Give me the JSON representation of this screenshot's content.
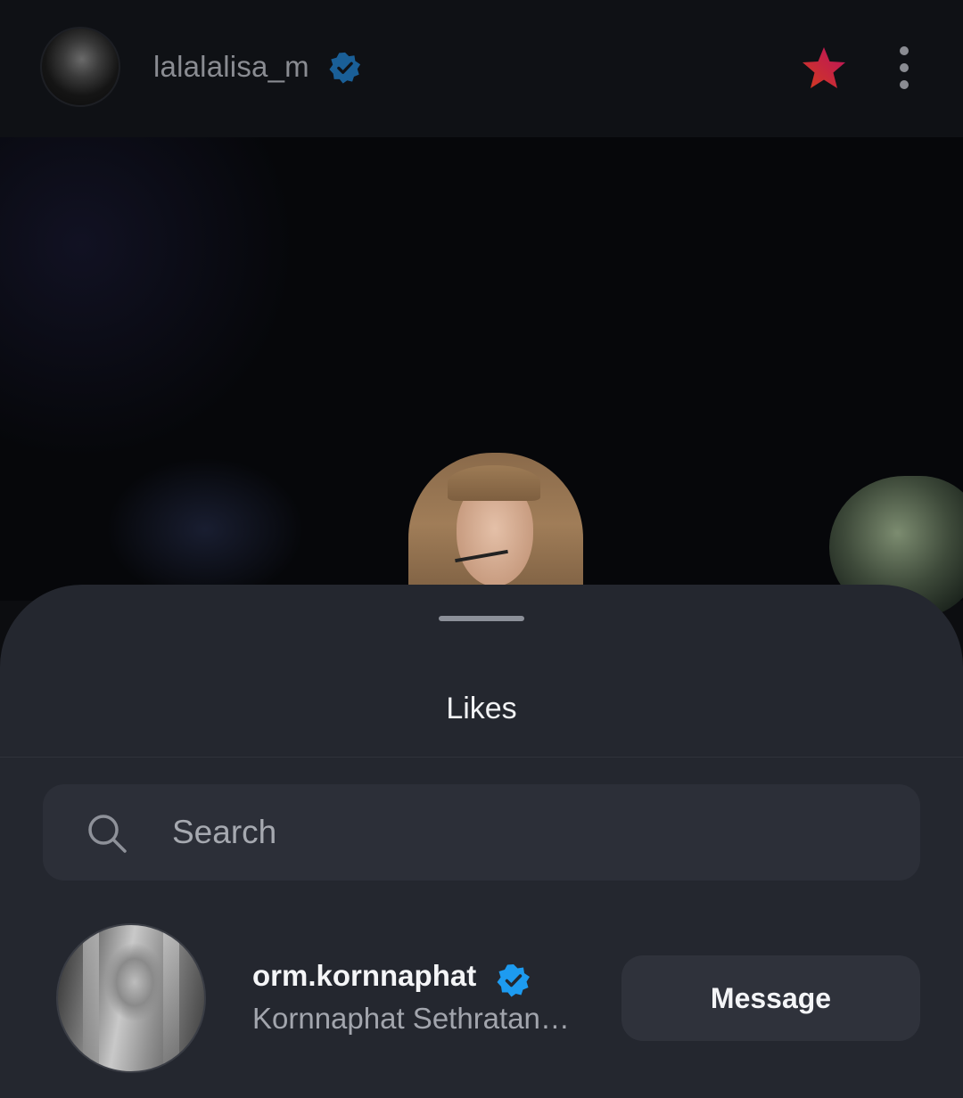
{
  "post_header": {
    "username": "lalalalisa_m",
    "verified_icon": "verified-badge-icon",
    "favorite_icon": "star-icon",
    "more_icon": "more-vertical-icon"
  },
  "likes_sheet": {
    "title": "Likes",
    "search": {
      "placeholder": "Search",
      "value": ""
    },
    "users": [
      {
        "username": "orm.kornnaphat",
        "full_name": "Kornnaphat Sethratan…",
        "verified": true,
        "action_label": "Message"
      }
    ]
  },
  "colors": {
    "sheet_background": "#24272f",
    "verified_blue": "#1d9bf0",
    "star_gradient_start": "#f5431f",
    "star_gradient_end": "#d9126b"
  }
}
